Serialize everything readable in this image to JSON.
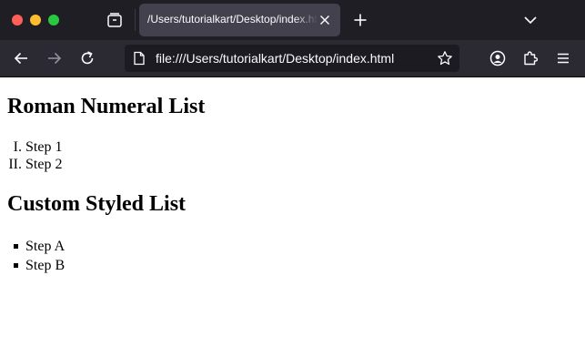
{
  "browser": {
    "tab": {
      "title": "/Users/tutorialkart/Desktop/index.html"
    },
    "url": "file:///Users/tutorialkart/Desktop/index.html"
  },
  "page": {
    "roman_heading": "Roman Numeral List",
    "roman_items": [
      {
        "marker": "I.",
        "text": "Step 1"
      },
      {
        "marker": "II.",
        "text": "Step 2"
      }
    ],
    "custom_heading": "Custom Styled List",
    "custom_items": [
      {
        "text": "Step A"
      },
      {
        "text": "Step B"
      }
    ]
  },
  "colors": {
    "titlebar": "#1f1e25",
    "toolbar": "#2b2a33",
    "active_tab": "#42414d",
    "urlbar": "#1c1b22",
    "close_dot": "#fe5f57",
    "minimize_dot": "#febc2e",
    "zoom_dot": "#28c840"
  },
  "icons": [
    "tab-manager-icon",
    "close-icon",
    "plus-icon",
    "chevron-down-icon",
    "arrow-left-icon",
    "arrow-right-icon",
    "reload-icon",
    "page-icon",
    "star-icon",
    "account-icon",
    "extensions-icon",
    "hamburger-menu-icon"
  ]
}
